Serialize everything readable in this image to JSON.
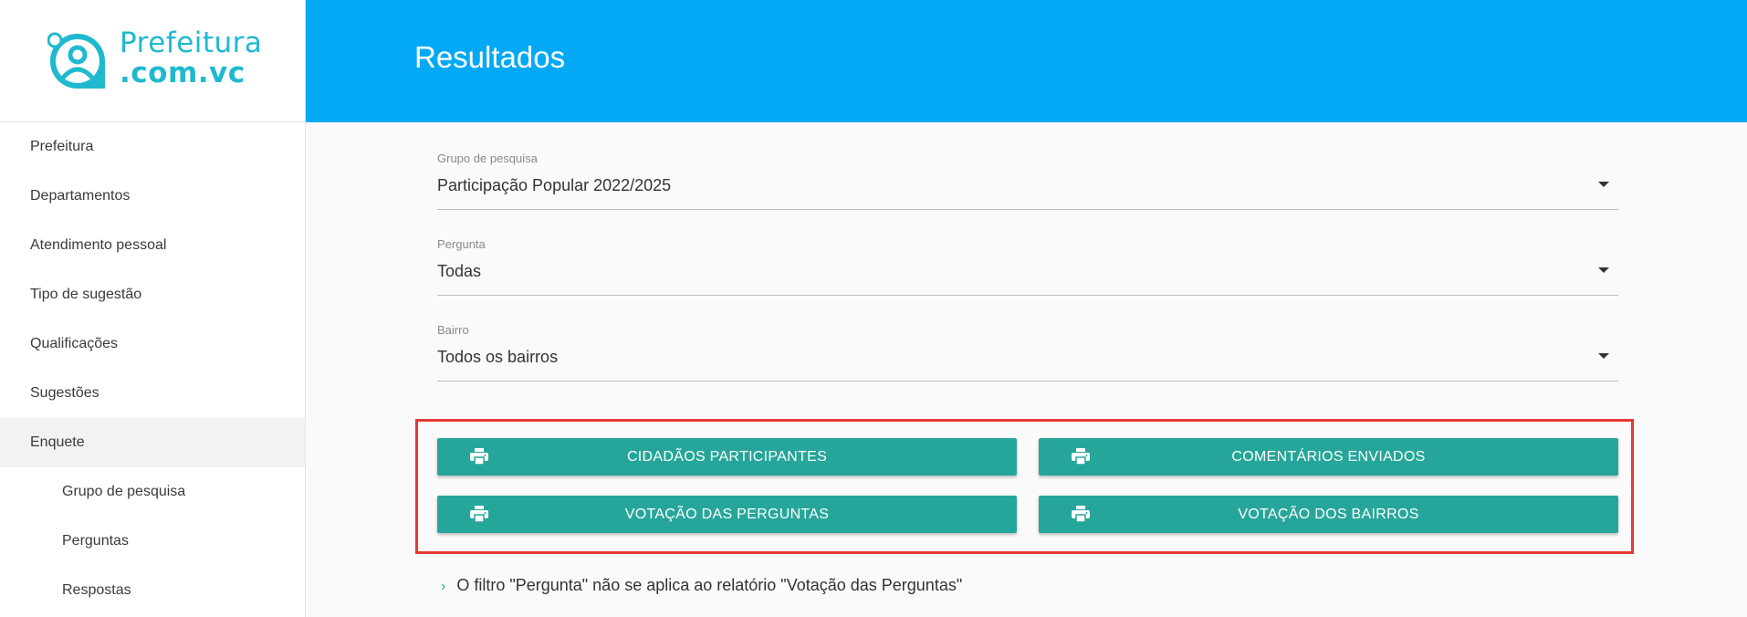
{
  "brand": {
    "line1": "Prefeitura",
    "line2": ".com.vc",
    "color": "#1fb9cf"
  },
  "header": {
    "title": "Resultados",
    "color": "#03a9f4"
  },
  "sidebar": {
    "items": [
      {
        "label": "Prefeitura"
      },
      {
        "label": "Departamentos"
      },
      {
        "label": "Atendimento pessoal"
      },
      {
        "label": "Tipo de sugestão"
      },
      {
        "label": "Qualificações"
      },
      {
        "label": "Sugestões"
      },
      {
        "label": "Enquete"
      },
      {
        "label": "Grupo de pesquisa"
      },
      {
        "label": "Perguntas"
      },
      {
        "label": "Respostas"
      }
    ]
  },
  "filters": {
    "grupo": {
      "label": "Grupo de pesquisa",
      "value": "Participação Popular 2022/2025"
    },
    "pergunta": {
      "label": "Pergunta",
      "value": "Todas"
    },
    "bairro": {
      "label": "Bairro",
      "value": "Todos os bairros"
    }
  },
  "reports": {
    "cidadaos": "CIDADÃOS PARTICIPANTES",
    "comentarios": "COMENTÁRIOS ENVIADOS",
    "votacao_perguntas": "VOTAÇÃO DAS PERGUNTAS",
    "votacao_bairros": "VOTAÇÃO DOS BAIRROS",
    "button_color": "#26a69a",
    "highlight_color": "#e53935"
  },
  "note": {
    "icon": "chevron-right-icon",
    "text": "O filtro \"Pergunta\" não se aplica ao relatório \"Votação das Perguntas\""
  }
}
